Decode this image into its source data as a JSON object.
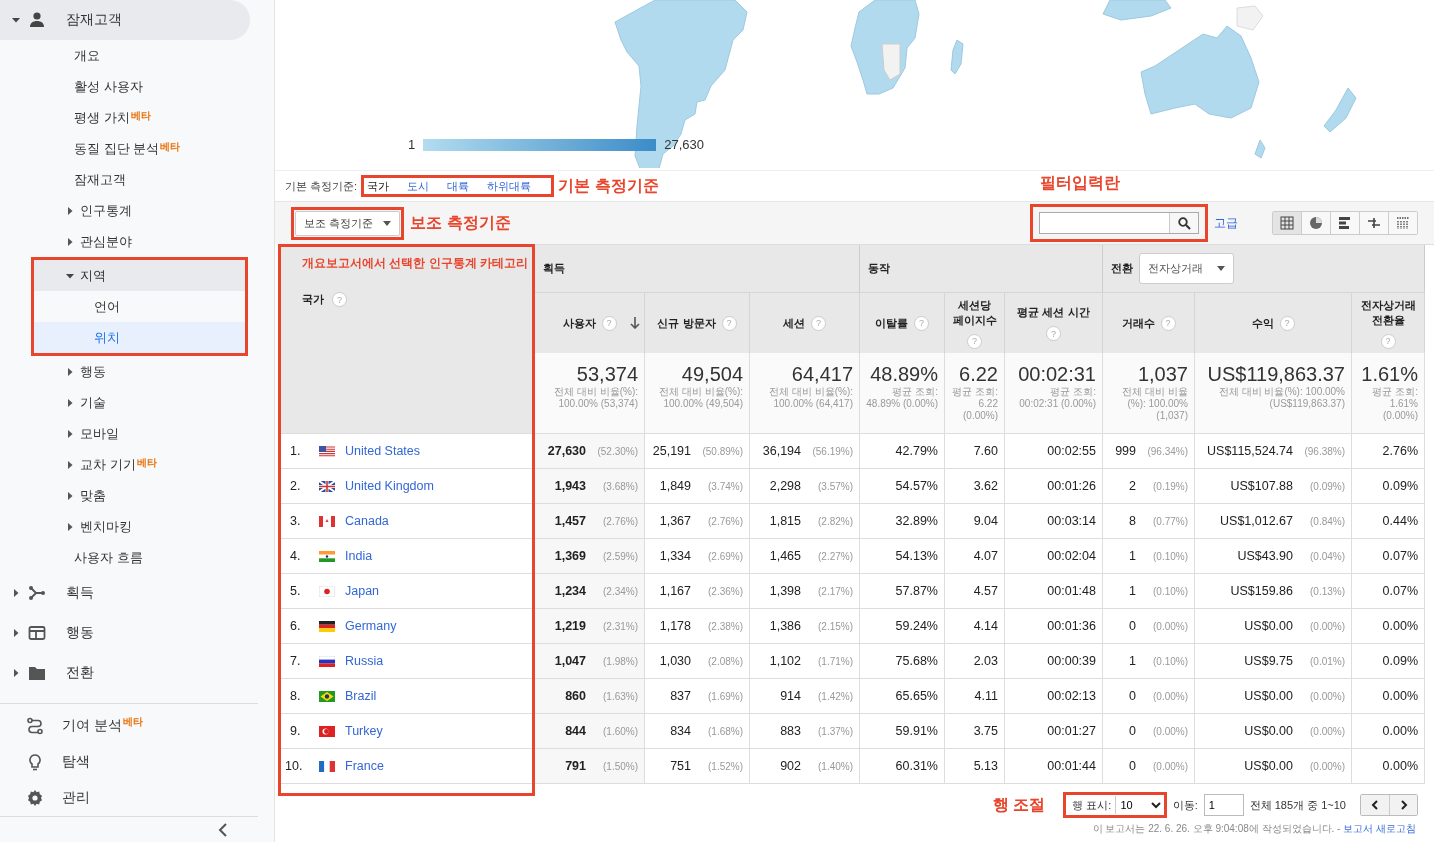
{
  "sidebar": {
    "sections": [
      {
        "label": "잠재고객",
        "kind": "person",
        "expanded": true,
        "children": [
          {
            "label": "개요",
            "kind": "link",
            "selected": false
          },
          {
            "label": "활성 사용자",
            "kind": "link",
            "selected": false
          },
          {
            "label": "평생 가치",
            "kind": "link",
            "badge": "베타",
            "selected": false
          },
          {
            "label": "동질 집단 분석",
            "kind": "link",
            "badge": "베타",
            "selected": false
          },
          {
            "label": "잠재고객",
            "kind": "link",
            "selected": false
          },
          {
            "label": "인구통계",
            "kind": "group",
            "expanded": false,
            "annotated": false
          },
          {
            "label": "관심분야",
            "kind": "group",
            "expanded": false,
            "annotated": false
          },
          {
            "label": "지역",
            "kind": "group",
            "expanded": true,
            "annotated": true,
            "children": [
              {
                "label": "언어",
                "kind": "link",
                "selected": false
              },
              {
                "label": "위치",
                "kind": "link",
                "selected": true
              }
            ]
          },
          {
            "label": "행동",
            "kind": "group",
            "expanded": false,
            "annotated": false
          },
          {
            "label": "기술",
            "kind": "group",
            "expanded": false,
            "annotated": false
          },
          {
            "label": "모바일",
            "kind": "group",
            "expanded": false,
            "annotated": false
          },
          {
            "label": "교차 기기",
            "kind": "group",
            "badge": "베타",
            "expanded": false,
            "annotated": false
          },
          {
            "label": "맞춤",
            "kind": "group",
            "expanded": false,
            "annotated": false
          },
          {
            "label": "벤치마킹",
            "kind": "group",
            "expanded": false,
            "annotated": false
          },
          {
            "label": "사용자 흐름",
            "kind": "link",
            "selected": false
          }
        ]
      },
      {
        "label": "획득",
        "kind": "branch",
        "expanded": false
      },
      {
        "label": "행동",
        "kind": "window",
        "expanded": false
      },
      {
        "label": "전환",
        "kind": "folder",
        "expanded": false
      }
    ],
    "bottom": [
      {
        "label": "기여 분석",
        "badge": "베타",
        "kind": "route"
      },
      {
        "label": "탐색",
        "kind": "bulb"
      },
      {
        "label": "관리",
        "kind": "gear"
      }
    ]
  },
  "map": {
    "legend_min": "1",
    "legend_max": "27,630"
  },
  "primary_dimension": {
    "label": "기본 측정기준:",
    "annotation": "기본 측정기준",
    "options": [
      {
        "label": "국가",
        "selected": true
      },
      {
        "label": "도시",
        "selected": false
      },
      {
        "label": "대륙",
        "selected": false
      },
      {
        "label": "하위대륙",
        "selected": false
      }
    ]
  },
  "secondary_dimension": {
    "label": "보조 측정기준",
    "annotation": "보조 측정기준"
  },
  "filter": {
    "annotation": "필터입력란",
    "advanced": "고급",
    "views": [
      {
        "kind": "table",
        "selected": true
      },
      {
        "kind": "pie",
        "selected": false
      },
      {
        "kind": "bar",
        "selected": false
      },
      {
        "kind": "compare",
        "selected": false
      },
      {
        "kind": "pivot",
        "selected": false
      }
    ]
  },
  "table": {
    "dimension": {
      "label": "국가",
      "help": "?",
      "annotation": "개요보고서에서 선택한 인구통계 카테고리"
    },
    "groups": [
      {
        "label": "획득",
        "columns": [
          {
            "label": "사용자",
            "help": "?",
            "sorted": true
          },
          {
            "label": "신규 방문자",
            "help": "?",
            "sorted": false
          },
          {
            "label": "세션",
            "help": "?",
            "sorted": false
          }
        ]
      },
      {
        "label": "동작",
        "columns": [
          {
            "label": "이탈률",
            "help": "?",
            "sorted": false
          },
          {
            "label": "세션당 페이지수",
            "help": "?",
            "sorted": false
          },
          {
            "label": "평균 세션 시간",
            "help": "?",
            "sorted": false
          }
        ]
      },
      {
        "label": "전환",
        "dropdown": "전자상거래",
        "columns": [
          {
            "label": "거래수",
            "help": "?",
            "sorted": false
          },
          {
            "label": "수익",
            "help": "?",
            "sorted": false
          },
          {
            "label": "전자상거래 전환율",
            "help": "?",
            "sorted": false
          }
        ]
      }
    ],
    "totals": [
      {
        "value": "53,374",
        "note": "전체 대비 비율(%): 100.00% (53,374)"
      },
      {
        "value": "49,504",
        "note": "전체 대비 비율(%): 100.00% (49,504)"
      },
      {
        "value": "64,417",
        "note": "전체 대비 비율(%): 100.00% (64,417)"
      },
      {
        "value": "48.89%",
        "note": "평균 조회: 48.89% (0.00%)"
      },
      {
        "value": "6.22",
        "note": "평균 조회: 6.22 (0.00%)"
      },
      {
        "value": "00:02:31",
        "note": "평균 조회: 00:02:31 (0.00%)"
      },
      {
        "value": "1,037",
        "note": "전체 대비 비율(%): 100.00% (1,037)"
      },
      {
        "value": "US$119,863.37",
        "note": "전체 대비 비율(%): 100.00% (US$119,863.37)"
      },
      {
        "value": "1.61%",
        "note": "평균 조회: 1.61% (0.00%)"
      }
    ],
    "rows": [
      {
        "rank": "1.",
        "country": "United States",
        "kind": "us",
        "cells": [
          {
            "value": "27,630",
            "share": "(52.30%)"
          },
          {
            "value": "25,191",
            "share": "(50.89%)"
          },
          {
            "value": "36,194",
            "share": "(56.19%)"
          },
          {
            "value": "42.79%"
          },
          {
            "value": "7.60"
          },
          {
            "value": "00:02:55"
          },
          {
            "value": "999",
            "share": "(96.34%)"
          },
          {
            "value": "US$115,524.74",
            "share": "(96.38%)"
          },
          {
            "value": "2.76%"
          }
        ]
      },
      {
        "rank": "2.",
        "country": "United Kingdom",
        "kind": "gb",
        "cells": [
          {
            "value": "1,943",
            "share": "(3.68%)"
          },
          {
            "value": "1,849",
            "share": "(3.74%)"
          },
          {
            "value": "2,298",
            "share": "(3.57%)"
          },
          {
            "value": "54.57%"
          },
          {
            "value": "3.62"
          },
          {
            "value": "00:01:26"
          },
          {
            "value": "2",
            "share": "(0.19%)"
          },
          {
            "value": "US$107.88",
            "share": "(0.09%)"
          },
          {
            "value": "0.09%"
          }
        ]
      },
      {
        "rank": "3.",
        "country": "Canada",
        "kind": "ca",
        "cells": [
          {
            "value": "1,457",
            "share": "(2.76%)"
          },
          {
            "value": "1,367",
            "share": "(2.76%)"
          },
          {
            "value": "1,815",
            "share": "(2.82%)"
          },
          {
            "value": "32.89%"
          },
          {
            "value": "9.04"
          },
          {
            "value": "00:03:14"
          },
          {
            "value": "8",
            "share": "(0.77%)"
          },
          {
            "value": "US$1,012.67",
            "share": "(0.84%)"
          },
          {
            "value": "0.44%"
          }
        ]
      },
      {
        "rank": "4.",
        "country": "India",
        "kind": "in",
        "cells": [
          {
            "value": "1,369",
            "share": "(2.59%)"
          },
          {
            "value": "1,334",
            "share": "(2.69%)"
          },
          {
            "value": "1,465",
            "share": "(2.27%)"
          },
          {
            "value": "54.13%"
          },
          {
            "value": "4.07"
          },
          {
            "value": "00:02:04"
          },
          {
            "value": "1",
            "share": "(0.10%)"
          },
          {
            "value": "US$43.90",
            "share": "(0.04%)"
          },
          {
            "value": "0.07%"
          }
        ]
      },
      {
        "rank": "5.",
        "country": "Japan",
        "kind": "jp",
        "cells": [
          {
            "value": "1,234",
            "share": "(2.34%)"
          },
          {
            "value": "1,167",
            "share": "(2.36%)"
          },
          {
            "value": "1,398",
            "share": "(2.17%)"
          },
          {
            "value": "57.87%"
          },
          {
            "value": "4.57"
          },
          {
            "value": "00:01:48"
          },
          {
            "value": "1",
            "share": "(0.10%)"
          },
          {
            "value": "US$159.86",
            "share": "(0.13%)"
          },
          {
            "value": "0.07%"
          }
        ]
      },
      {
        "rank": "6.",
        "country": "Germany",
        "kind": "de",
        "cells": [
          {
            "value": "1,219",
            "share": "(2.31%)"
          },
          {
            "value": "1,178",
            "share": "(2.38%)"
          },
          {
            "value": "1,386",
            "share": "(2.15%)"
          },
          {
            "value": "59.24%"
          },
          {
            "value": "4.14"
          },
          {
            "value": "00:01:36"
          },
          {
            "value": "0",
            "share": "(0.00%)"
          },
          {
            "value": "US$0.00",
            "share": "(0.00%)"
          },
          {
            "value": "0.00%"
          }
        ]
      },
      {
        "rank": "7.",
        "country": "Russia",
        "kind": "ru",
        "cells": [
          {
            "value": "1,047",
            "share": "(1.98%)"
          },
          {
            "value": "1,030",
            "share": "(2.08%)"
          },
          {
            "value": "1,102",
            "share": "(1.71%)"
          },
          {
            "value": "75.68%"
          },
          {
            "value": "2.03"
          },
          {
            "value": "00:00:39"
          },
          {
            "value": "1",
            "share": "(0.10%)"
          },
          {
            "value": "US$9.75",
            "share": "(0.01%)"
          },
          {
            "value": "0.09%"
          }
        ]
      },
      {
        "rank": "8.",
        "country": "Brazil",
        "kind": "br",
        "cells": [
          {
            "value": "860",
            "share": "(1.63%)"
          },
          {
            "value": "837",
            "share": "(1.69%)"
          },
          {
            "value": "914",
            "share": "(1.42%)"
          },
          {
            "value": "65.65%"
          },
          {
            "value": "4.11"
          },
          {
            "value": "00:02:13"
          },
          {
            "value": "0",
            "share": "(0.00%)"
          },
          {
            "value": "US$0.00",
            "share": "(0.00%)"
          },
          {
            "value": "0.00%"
          }
        ]
      },
      {
        "rank": "9.",
        "country": "Turkey",
        "kind": "tr",
        "cells": [
          {
            "value": "844",
            "share": "(1.60%)"
          },
          {
            "value": "834",
            "share": "(1.68%)"
          },
          {
            "value": "883",
            "share": "(1.37%)"
          },
          {
            "value": "59.91%"
          },
          {
            "value": "3.75"
          },
          {
            "value": "00:01:27"
          },
          {
            "value": "0",
            "share": "(0.00%)"
          },
          {
            "value": "US$0.00",
            "share": "(0.00%)"
          },
          {
            "value": "0.00%"
          }
        ]
      },
      {
        "rank": "10.",
        "country": "France",
        "kind": "fr",
        "cells": [
          {
            "value": "791",
            "share": "(1.50%)"
          },
          {
            "value": "751",
            "share": "(1.52%)"
          },
          {
            "value": "902",
            "share": "(1.40%)"
          },
          {
            "value": "60.31%"
          },
          {
            "value": "5.13"
          },
          {
            "value": "00:01:44"
          },
          {
            "value": "0",
            "share": "(0.00%)"
          },
          {
            "value": "US$0.00",
            "share": "(0.00%)"
          },
          {
            "value": "0.00%"
          }
        ]
      }
    ]
  },
  "pagination": {
    "annotation": "행 조절",
    "rows_label": "행 표시:",
    "rows_value": "10",
    "goto_label": "이동:",
    "goto_value": "1",
    "range": "전체 185개 중 1~10"
  },
  "report_note": {
    "text": "이 보고서는 22. 6. 26. 오후 9:04:08에 작성되었습니다. -",
    "link": "보고서 새로고침"
  }
}
